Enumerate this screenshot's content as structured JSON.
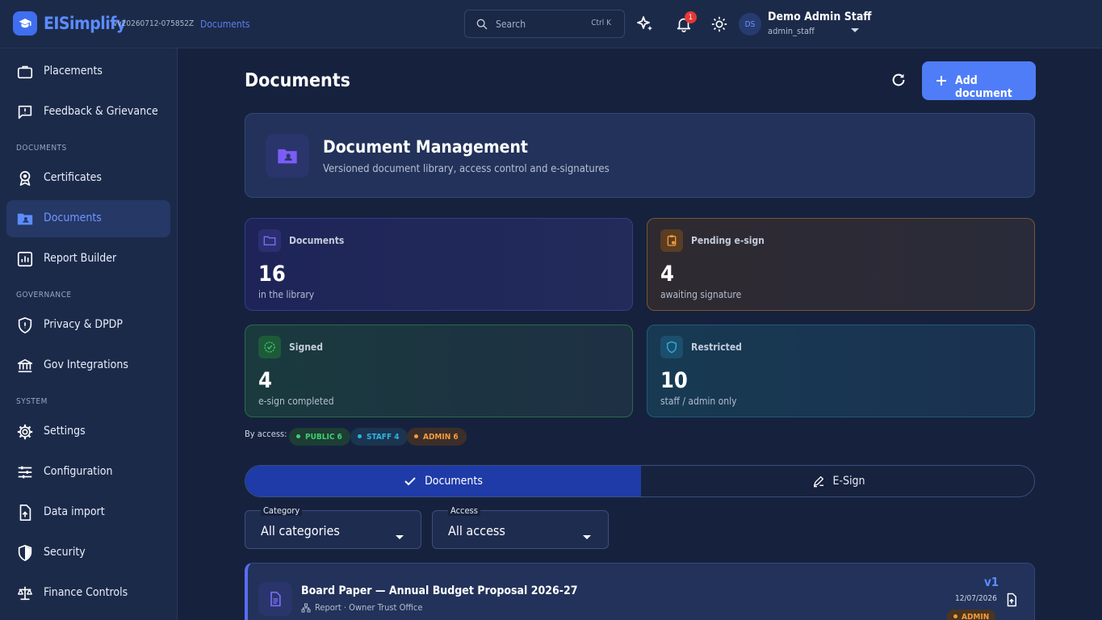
{
  "topbar": {
    "brand": "EISimplify",
    "version": "vv20260712-075852Z",
    "breadcrumb": "Documents",
    "search_placeholder": "Search",
    "search_shortcut": "Ctrl K",
    "notification_count": "1",
    "user": {
      "initials": "DS",
      "name": "Demo Admin Staff",
      "role": "admin_staff"
    }
  },
  "sidebar": {
    "items": [
      {
        "label": "Placements",
        "icon": "briefcase-icon"
      },
      {
        "label": "Feedback & Grievance",
        "icon": "feedback-icon"
      },
      {
        "section": "DOCUMENTS"
      },
      {
        "label": "Certificates",
        "icon": "award-icon"
      },
      {
        "label": "Documents",
        "icon": "folder-user-icon",
        "active": true
      },
      {
        "label": "Report Builder",
        "icon": "chart-icon"
      },
      {
        "section": "GOVERNANCE"
      },
      {
        "label": "Privacy & DPDP",
        "icon": "privacy-shield-icon"
      },
      {
        "label": "Gov Integrations",
        "icon": "bank-icon"
      },
      {
        "section": "SYSTEM"
      },
      {
        "label": "Settings",
        "icon": "gear-icon"
      },
      {
        "label": "Configuration",
        "icon": "sliders-icon"
      },
      {
        "label": "Data import",
        "icon": "file-upload-icon"
      },
      {
        "label": "Security",
        "icon": "shield-icon"
      },
      {
        "label": "Finance Controls",
        "icon": "scale-icon"
      }
    ]
  },
  "main": {
    "title": "Documents",
    "add_button": "Add document",
    "hero": {
      "title": "Document Management",
      "subtitle": "Versioned document library, access control and e-signatures"
    },
    "stats": [
      {
        "label": "Documents",
        "value": "16",
        "sub": "in the library"
      },
      {
        "label": "Pending e-sign",
        "value": "4",
        "sub": "awaiting signature"
      },
      {
        "label": "Signed",
        "value": "4",
        "sub": "e-sign completed"
      },
      {
        "label": "Restricted",
        "value": "10",
        "sub": "staff / admin only"
      }
    ],
    "by_access": {
      "label": "By access:",
      "chips": [
        {
          "text": "PUBLIC 6",
          "color": "#3ecf6e",
          "bg": "#1d3d35"
        },
        {
          "text": "STAFF 4",
          "color": "#2fb3e0",
          "bg": "#1b3450"
        },
        {
          "text": "ADMIN 6",
          "color": "#f39c3a",
          "bg": "#3c2e2a"
        }
      ]
    },
    "tabs": [
      {
        "label": "Documents",
        "active": true
      },
      {
        "label": "E-Sign",
        "active": false
      }
    ],
    "filters": [
      {
        "label": "Category",
        "value": "All categories"
      },
      {
        "label": "Access",
        "value": "All access"
      }
    ],
    "documents": [
      {
        "title": "Board Paper — Annual Budget Proposal 2026-27",
        "meta": "Report · Owner Trust Office",
        "version": "v1",
        "date": "12/07/2026",
        "access": "ADMIN"
      }
    ]
  },
  "colors": {
    "accent": "#4f7df7",
    "brand": "#5b8cff",
    "background": "#16223d",
    "sidebar": "#1c2a4a"
  }
}
